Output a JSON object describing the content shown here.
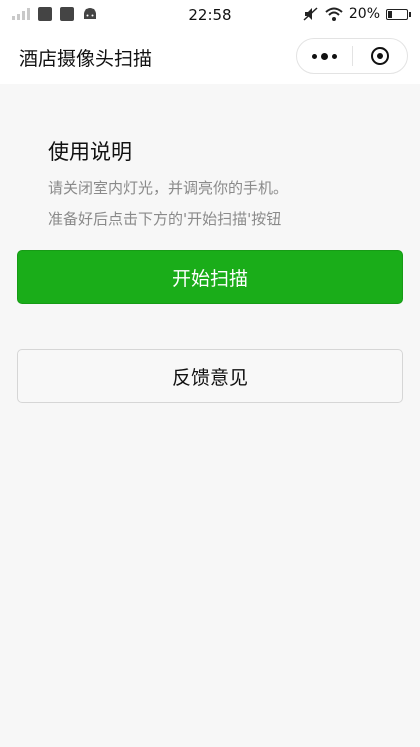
{
  "status_bar": {
    "time": "22:58",
    "battery": "20%",
    "battery_level": 0.2,
    "signal_icon": "signal-bars-icon",
    "notification_icons": [
      "sim-card-icon",
      "download-icon",
      "android-icon"
    ],
    "wifi_icon": "wifi-icon",
    "mute_icon": "mute-icon"
  },
  "navbar": {
    "title": "酒店摄像头扫描",
    "menu_icon": "more-dots-icon",
    "close_icon": "target-close-icon"
  },
  "instructions": {
    "title": "使用说明",
    "line1": "请关闭室内灯光，并调亮你的手机。",
    "line2": "准备好后点击下方的'开始扫描'按钮"
  },
  "buttons": {
    "start_scan": "开始扫描",
    "feedback": "反馈意见"
  },
  "colors": {
    "primary": "#1aad19",
    "background": "#f7f7f7"
  }
}
